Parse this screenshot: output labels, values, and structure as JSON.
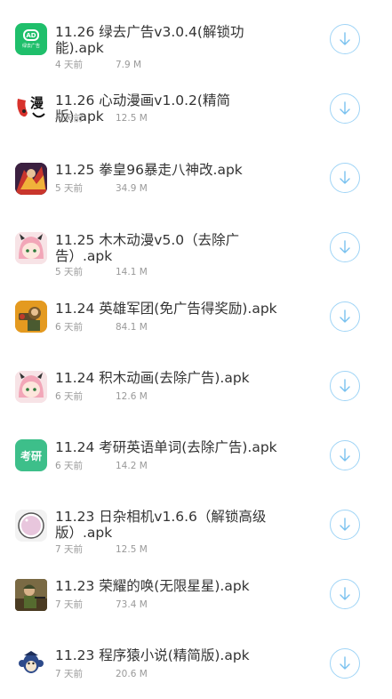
{
  "items": [
    {
      "title": "11.26 绿去广告v3.0.4(解锁功能).apk",
      "date": "4 天前",
      "size": "7.9 M",
      "icon": "green-ad-icon",
      "icon_text": "AD",
      "icon_subtext": "绿去广告"
    },
    {
      "title": "11.26 心动漫画v1.0.2(精简版).apk",
      "date": "4 天前",
      "size": "12.5 M",
      "icon": "manga-icon",
      "icon_text": "漫"
    },
    {
      "title": "11.25 拳皇96暴走八神改.apk",
      "date": "5 天前",
      "size": "34.9 M",
      "icon": "kof-icon"
    },
    {
      "title": "11.25 木木动漫v5.0（去除广告）.apk",
      "date": "5 天前",
      "size": "14.1 M",
      "icon": "anime-girl-icon"
    },
    {
      "title": "11.24 英雄军团(免广告得奖励).apk",
      "date": "6 天前",
      "size": "84.1 M",
      "icon": "hero-legion-icon"
    },
    {
      "title": "11.24 积木动画(去除广告).apk",
      "date": "6 天前",
      "size": "12.6 M",
      "icon": "anime-girl-icon"
    },
    {
      "title": "11.24 考研英语单词(去除广告).apk",
      "date": "6 天前",
      "size": "14.2 M",
      "icon": "kaoyan-icon",
      "icon_text": "考研"
    },
    {
      "title": "11.23 日杂相机v1.6.6（解锁高级版）.apk",
      "date": "7 天前",
      "size": "12.5 M",
      "icon": "camera-lens-icon"
    },
    {
      "title": "11.23 荣耀的唤(无限星星).apk",
      "date": "7 天前",
      "size": "73.4 M",
      "icon": "soldier-game-icon"
    },
    {
      "title": "11.23 程序猿小说(精简版).apk",
      "date": "7 天前",
      "size": "20.6 M",
      "icon": "monkey-icon"
    }
  ],
  "colors": {
    "title": "#333333",
    "meta": "#999999",
    "download_ring": "#9fd4f6",
    "download_arrow": "#79c1ef"
  }
}
